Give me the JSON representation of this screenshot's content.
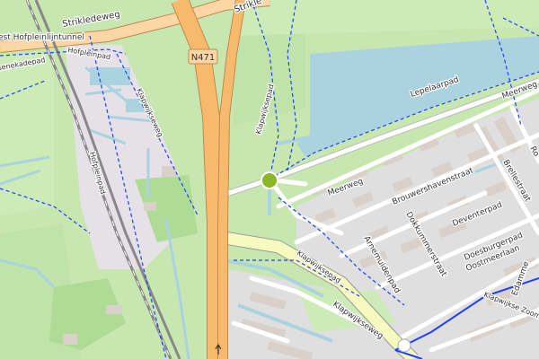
{
  "colors": {
    "meadow": "#c8e6b0",
    "grass": "#b8dfa0",
    "water": "#aad3df",
    "residential": "#e0dfdf",
    "building": "#d9d0c9",
    "motorway": "#f7b96b",
    "primary": "#fcd6a4",
    "path": "#1f3fff",
    "rail": "#777777"
  },
  "labels": {
    "strikledeweg_left": "Strikledeweg",
    "strikledeweg_right": "Strikle",
    "hofpleinlijntunnel": "est Hofpleinlijntunnel",
    "senekadepad": "senekadepad",
    "hofpleinpad_top": "Hofpleinpad",
    "hofpleinpad_side": "Hofpleinpad",
    "klapwijkseweg_left": "Klapwijkseweg",
    "klapwijksepad_top": "Klapwijksepad",
    "n471": "N471",
    "lepelaarpad": "Lepelaarpad",
    "meerweg_top": "Meerweg",
    "meerweg_mid": "Meerweg",
    "brellestraat": "Brellestraat",
    "brouwershavenstraat": "Brouwershavenstraat",
    "dokkummerstraat": "Dokkummerstraat",
    "deventerpad": "Deventerpad",
    "arnemuidenpad": "Arnemuidenpad",
    "doesburgerpad": "Doesburgerpad",
    "oostmeerlaan": "Oostmeerlaan",
    "klapwijkse_weg_label": "Klapwijkseweg",
    "klapwijksepad_bottom": "Klapwijksepad",
    "klapwijkse_zoom": "Klapwijkse Zoom",
    "edammer": "Edamme",
    "ro": "Ro"
  }
}
